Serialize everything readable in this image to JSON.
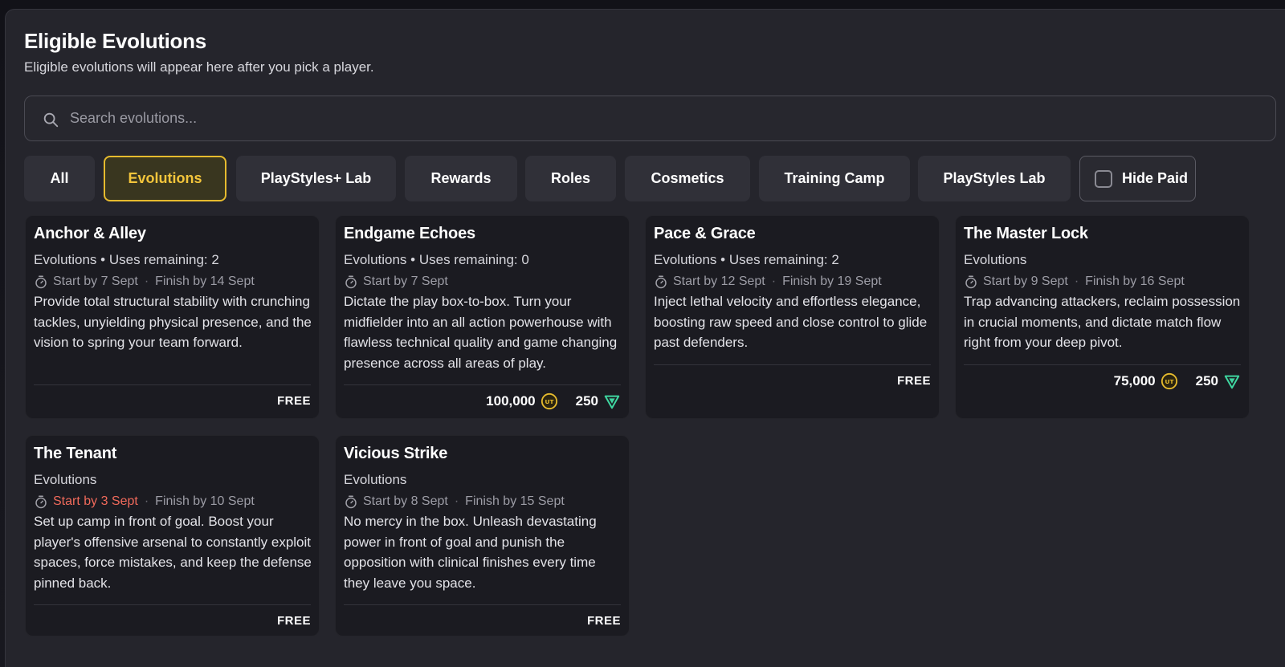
{
  "header": {
    "title": "Eligible Evolutions",
    "subtitle": "Eligible evolutions will appear here after you pick a player."
  },
  "search": {
    "placeholder": "Search evolutions...",
    "value": "",
    "icon": "search-icon"
  },
  "tabs": [
    {
      "label": "All",
      "active": false
    },
    {
      "label": "Evolutions",
      "active": true
    },
    {
      "label": "PlayStyles+ Lab",
      "active": false
    },
    {
      "label": "Rewards",
      "active": false
    },
    {
      "label": "Roles",
      "active": false
    },
    {
      "label": "Cosmetics",
      "active": false
    },
    {
      "label": "Training Camp",
      "active": false
    },
    {
      "label": "PlayStyles Lab",
      "active": false
    }
  ],
  "hide_paid": {
    "label": "Hide Paid",
    "checked": false
  },
  "colors": {
    "accent": "#e6bb2e",
    "panel": "#25252c",
    "card": "#1b1b21",
    "urgent": "#f06a5b"
  },
  "cards": [
    {
      "title": "Anchor & Alley",
      "meta": "Evolutions • Uses remaining: 2",
      "start": "Start by 7 Sept",
      "finish": "Finish by 14 Sept",
      "description": "Provide total structural stability with crunching tackles, unyielding physical presence, and the vision to spring your team forward.",
      "price": {
        "free_label": "FREE"
      }
    },
    {
      "title": "Endgame Echoes",
      "meta": "Evolutions • Uses remaining: 0",
      "start": "Start by 7 Sept",
      "finish": "",
      "description": "Dictate the play box-to-box. Turn your midfielder into an all action powerhouse with flawless technical quality and game changing presence across all areas of play.",
      "price": {
        "coins": "100,000",
        "points": "250"
      }
    },
    {
      "title": "Pace & Grace",
      "meta": "Evolutions • Uses remaining: 2",
      "start": "Start by 12 Sept",
      "finish": "Finish by 19 Sept",
      "description": "Inject lethal velocity and effortless elegance, boosting raw speed and close control to glide past defenders.",
      "price": {
        "free_label": "FREE"
      }
    },
    {
      "title": "The Master Lock",
      "meta": "Evolutions",
      "start": "Start by 9 Sept",
      "finish": "Finish by 16 Sept",
      "description": "Trap advancing attackers, reclaim possession in crucial moments, and dictate match flow right from your deep pivot.",
      "price": {
        "coins": "75,000",
        "points": "250"
      }
    },
    {
      "title": "The Tenant",
      "meta": "Evolutions",
      "start": "Start by 3 Sept",
      "finish": "Finish by 10 Sept",
      "description": "Set up camp in front of goal. Boost your player's offensive arsenal to constantly exploit spaces, force mistakes, and keep the defense pinned back.",
      "price": {
        "free_label": "FREE"
      }
    },
    {
      "title": "Vicious Strike",
      "meta": "Evolutions",
      "start": "Start by 8 Sept",
      "finish": "Finish by 15 Sept",
      "description": "No mercy in the box. Unleash devastating power in front of goal and punish the opposition with clinical finishes every time they leave you space.",
      "price": {
        "free_label": "FREE"
      }
    }
  ]
}
